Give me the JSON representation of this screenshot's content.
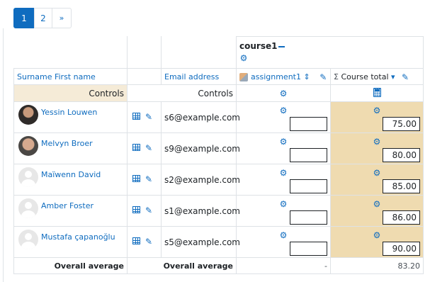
{
  "pagination": {
    "pages": [
      "1",
      "2"
    ],
    "next": "»",
    "current": "1"
  },
  "course": {
    "title": "course1"
  },
  "columns": {
    "name": "Surname First name",
    "email": "Email address",
    "assignment": "assignment1",
    "total": "Course total",
    "total_symbol": "Σ"
  },
  "controls": {
    "label1": "Controls",
    "label2": "Controls"
  },
  "users": [
    {
      "name": "Yessin Louwen",
      "email": "s6@example.com",
      "assignment": "",
      "total": "75.00"
    },
    {
      "name": "Melvyn Broer",
      "email": "s9@example.com",
      "assignment": "",
      "total": "80.00"
    },
    {
      "name": "Maïwenn David",
      "email": "s2@example.com",
      "assignment": "",
      "total": "85.00"
    },
    {
      "name": "Amber Foster",
      "email": "s1@example.com",
      "assignment": "",
      "total": "86.00"
    },
    {
      "name": "Mustafa çapanoğlu",
      "email": "s5@example.com",
      "assignment": "",
      "total": "90.00"
    }
  ],
  "average": {
    "label1": "Overall average",
    "label2": "Overall average",
    "assignment": "-",
    "total": "83.20"
  },
  "icons": {
    "gear": "cog-icon",
    "pencil": "pencil-icon",
    "grid": "single-view-icon",
    "calculator": "calculator-icon",
    "sort": "sort-icon",
    "caret": "caret-down-icon"
  },
  "colors": {
    "accent": "#0f6cbf",
    "controls_bg": "#f5ebd7",
    "total_bg": "#efdbb0"
  }
}
